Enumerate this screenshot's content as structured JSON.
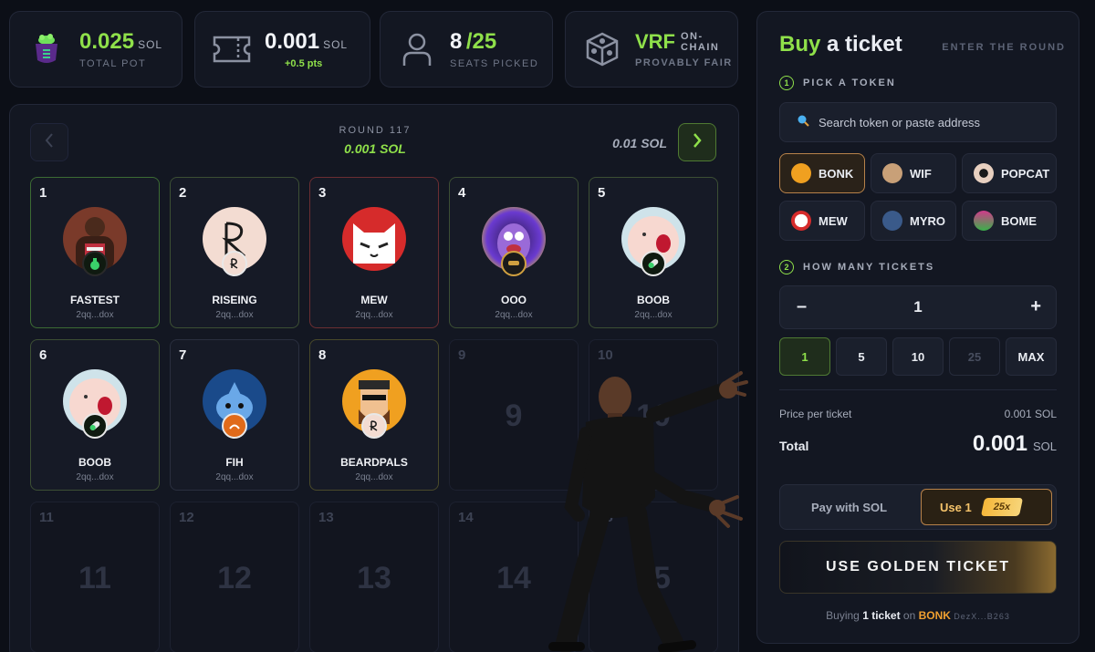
{
  "stats": {
    "pot": {
      "value": "0.025",
      "unit": "SOL",
      "label": "TOTAL POT",
      "icon": "cauldron-icon"
    },
    "price": {
      "value": "0.001",
      "unit": "SOL",
      "sub": "+0.5 pts",
      "icon": "ticket-icon"
    },
    "seats": {
      "picked": "8",
      "total": "/25",
      "label": "SEATS PICKED",
      "icon": "user-icon"
    },
    "vrf": {
      "title": "VRF",
      "line1": "ON-",
      "line2": "CHAIN",
      "label": "PROVABLY FAIR",
      "icon": "dice-icon"
    }
  },
  "round": {
    "label": "ROUND 117",
    "price": "0.001 SOL",
    "next_price": "0.01 SOL"
  },
  "seats": [
    {
      "num": "1",
      "name": "FASTEST",
      "addr": "2qq...dox"
    },
    {
      "num": "2",
      "name": "RISEING",
      "addr": "2qq...dox"
    },
    {
      "num": "3",
      "name": "MEW",
      "addr": "2qq...dox"
    },
    {
      "num": "4",
      "name": "OOO",
      "addr": "2qq...dox"
    },
    {
      "num": "5",
      "name": "BOOB",
      "addr": "2qq...dox"
    },
    {
      "num": "6",
      "name": "BOOB",
      "addr": "2qq...dox"
    },
    {
      "num": "7",
      "name": "FIH",
      "addr": "2qq...dox"
    },
    {
      "num": "8",
      "name": "BEARDPALS",
      "addr": "2qq...dox"
    }
  ],
  "empty_seats": [
    "9",
    "10",
    "11",
    "12",
    "13",
    "14",
    "15"
  ],
  "panel": {
    "title_green": "Buy",
    "title_rest": " a ticket",
    "enter": "ENTER THE ROUND",
    "step1_num": "1",
    "step1": "PICK A TOKEN",
    "search_placeholder": "Search token or paste address",
    "tokens": [
      "BONK",
      "WIF",
      "POPCAT",
      "MEW",
      "MYRO",
      "BOME"
    ],
    "step2_num": "2",
    "step2": "HOW MANY TICKETS",
    "minus": "–",
    "plus": "+",
    "quantity": "1",
    "quick": [
      "1",
      "5",
      "10",
      "25",
      "MAX"
    ],
    "price_label": "Price per ticket",
    "price_value": "0.001 SOL",
    "total_label": "Total",
    "total_value": "0.001",
    "total_unit": "SOL",
    "pay_sol": "Pay with SOL",
    "use_label": "Use 1",
    "multiplier": "25x",
    "golden": "USE GOLDEN TICKET",
    "footer_pre": "Buying",
    "footer_count": "1 ticket",
    "footer_on": "on",
    "footer_token": "BONK",
    "footer_addr": "DezX...B263"
  },
  "colors": {
    "accent": "#8fe04a",
    "gold": "#f5c36a",
    "bg": "#0c0f17"
  }
}
